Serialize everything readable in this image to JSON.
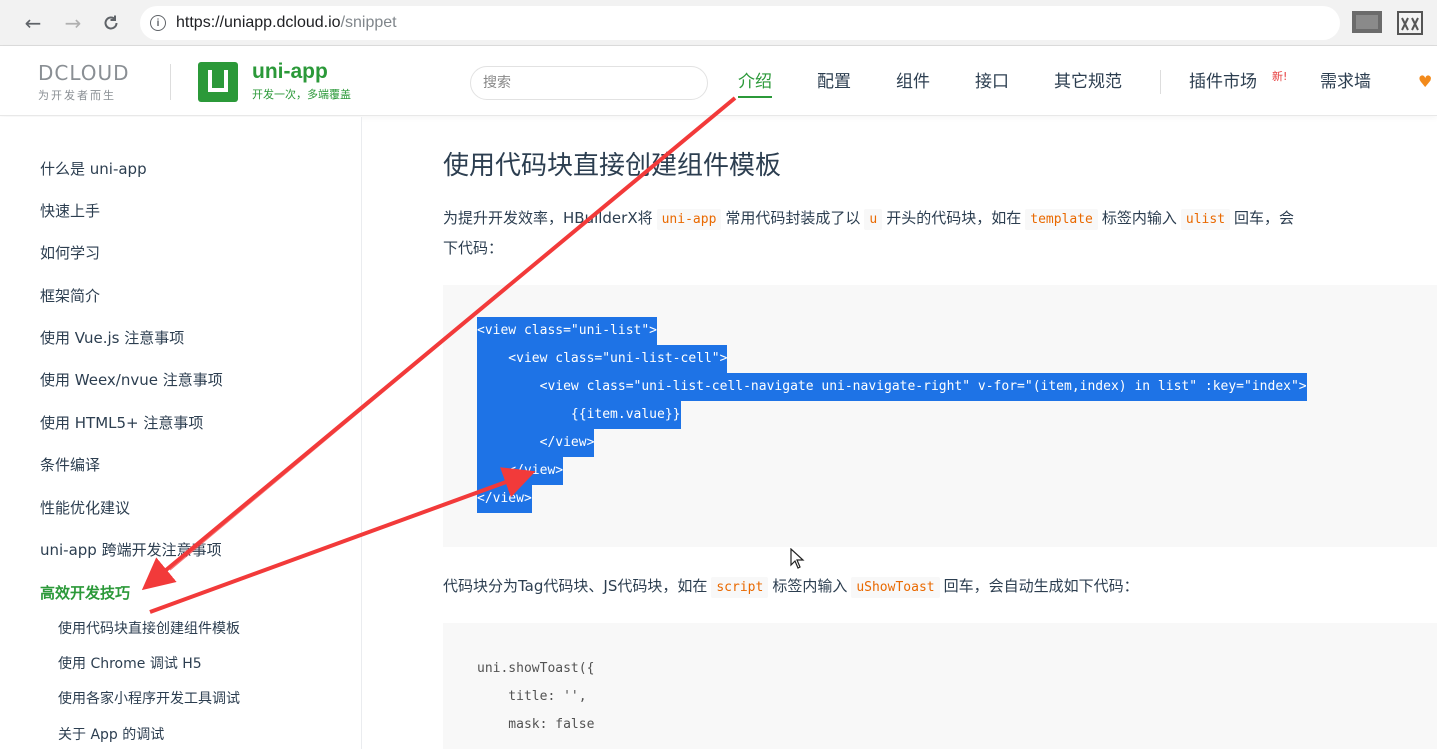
{
  "browser": {
    "url_host": "https://uniapp.dcloud.io",
    "url_path": "/snippet"
  },
  "header": {
    "dcloud_logo": "DCLOUD",
    "dcloud_slogan": "为开发者而生",
    "uni_name": "uni-app",
    "uni_sub": "开发一次，多端覆盖",
    "search_placeholder": "搜索",
    "nav": [
      "介绍",
      "配置",
      "组件",
      "接口",
      "其它规范",
      "插件市场",
      "需求墙"
    ],
    "new_badge": "新!"
  },
  "sidebar": {
    "items": [
      "什么是 uni-app",
      "快速上手",
      "如何学习",
      "框架简介",
      "使用 Vue.js 注意事项",
      "使用 Weex/nvue 注意事项",
      "使用 HTML5+ 注意事项",
      "条件编译",
      "性能优化建议",
      "uni-app 跨端开发注意事项",
      "高效开发技巧"
    ],
    "subitems": [
      "使用代码块直接创建组件模板",
      "使用 Chrome 调试 H5",
      "使用各家小程序开发工具调试",
      "关于 App 的调试"
    ]
  },
  "content": {
    "title": "使用代码块直接创建组件模板",
    "p1_a": "为提升开发效率，HBuilderX将",
    "p1_code1": "uni-app",
    "p1_b": "常用代码封装成了以",
    "p1_code2": "u",
    "p1_c": "开头的代码块，如在",
    "p1_code3": "template",
    "p1_d": "标签内输入",
    "p1_code4": "ulist",
    "p1_e": "回车，会",
    "p1_line2": "下代码：",
    "code1": [
      "<view class=\"uni-list\">",
      "    <view class=\"uni-list-cell\">",
      "        <view class=\"uni-list-cell-navigate uni-navigate-right\" v-for=\"(item,index) in list\" :key=\"index\">",
      "            {{item.value}}",
      "        </view>",
      "    </view>",
      "</view>"
    ],
    "p2_a": "代码块分为Tag代码块、JS代码块，如在",
    "p2_code1": "script",
    "p2_b": "标签内输入",
    "p2_code2": "uShowToast",
    "p2_c": "回车，会自动生成如下代码：",
    "code2": [
      "uni.showToast({",
      "    title: '',",
      "    mask: false"
    ]
  },
  "colors": {
    "brand_green": "#2b9939",
    "selection_blue": "#1e73e6",
    "inline_code": "#e96900",
    "arrow_red": "#f23a3a"
  }
}
